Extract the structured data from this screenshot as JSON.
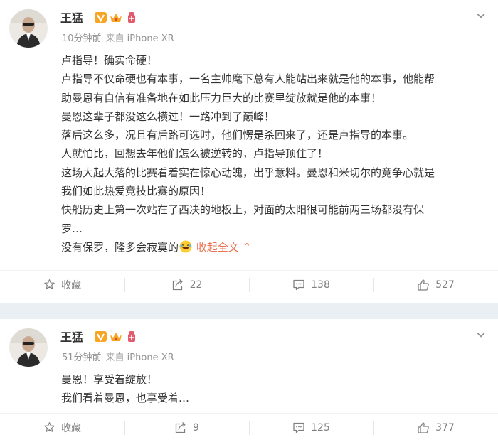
{
  "posts": [
    {
      "author": "王猛",
      "time": "10分钟前",
      "source": "来自 iPhone XR",
      "lines": [
        "卢指导！确实命硬！",
        "卢指导不仅命硬也有本事，一名主帅麾下总有人能站出来就是他的本事，他能帮",
        "助曼恩有自信有准备地在如此压力巨大的比赛里绽放就是他的本事！",
        "曼恩这辈子都没这么横过！一路冲到了巅峰！",
        "落后这么多，况且有后路可选时，他们愣是杀回来了，还是卢指导的本事。",
        "人就怕比，回想去年他们怎么被逆转的，卢指导顶住了！",
        "这场大起大落的比赛看着实在惊心动魄，出乎意料。曼恩和米切尔的竞争心就是",
        "我们如此热爱竞技比赛的原因！",
        "快船历史上第一次站在了西决的地板上，对面的太阳很可能前两三场都没有保",
        "罗…"
      ],
      "last_line": "没有保罗，隆多会寂寞的",
      "collapse_label": "收起全文",
      "collapse_arrow": "⌃",
      "actions": {
        "favorite": "收藏",
        "repost": "22",
        "comment": "138",
        "like": "527"
      }
    },
    {
      "author": "王猛",
      "time": "51分钟前",
      "source": "来自 iPhone XR",
      "lines": [
        "曼恩！享受着绽放！",
        "我们看着曼恩，也享受着…"
      ],
      "actions": {
        "favorite": "收藏",
        "repost": "9",
        "comment": "125",
        "like": "377"
      }
    }
  ],
  "icons": {
    "verified": "verified-v-icon",
    "vip": "vip-crown-icon",
    "sport": "sport-badge-icon",
    "menu": "chevron-down-icon",
    "favorite": "star-icon",
    "repost": "repost-icon",
    "comment": "comment-icon",
    "like": "thumbs-up-icon",
    "emoji": "laughing-emoji-icon"
  },
  "colors": {
    "link": "#eb7350",
    "verified": "#f6a623",
    "separator": "#e9eff2",
    "meta": "#939393",
    "action": "#808080"
  }
}
